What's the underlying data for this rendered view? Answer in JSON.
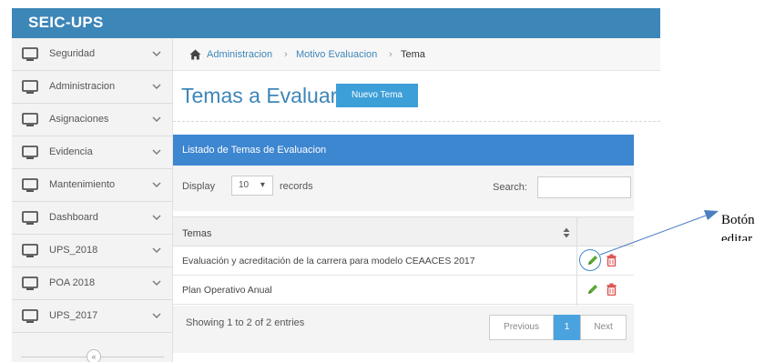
{
  "app": {
    "brand": "SEIC-UPS"
  },
  "sidebar": {
    "items": [
      {
        "label": "Seguridad"
      },
      {
        "label": "Administracion"
      },
      {
        "label": "Asignaciones"
      },
      {
        "label": "Evidencia"
      },
      {
        "label": "Mantenimiento"
      },
      {
        "label": "Dashboard"
      },
      {
        "label": "UPS_2018"
      },
      {
        "label": "POA 2018"
      },
      {
        "label": "UPS_2017"
      }
    ],
    "collapse_glyph": "«"
  },
  "breadcrumb": {
    "items": [
      "Administracion",
      "Motivo Evaluacion",
      "Tema"
    ],
    "separator": "›"
  },
  "page": {
    "title": "Temas a Evaluar",
    "new_button": "Nuevo Tema"
  },
  "panel": {
    "heading": "Listado de Temas de Evaluacion",
    "display_label": "Display",
    "length_value": "10",
    "length_arrow": "▾",
    "records_label": "records",
    "search_label": "Search:",
    "search_value": ""
  },
  "table": {
    "column_header": "Temas",
    "rows": [
      {
        "tema": "Evaluación y acreditación de la carrera para modelo CEAACES 2017"
      },
      {
        "tema": "Plan Operativo Anual"
      }
    ],
    "info": "Showing 1 to 2 of 2 entries",
    "pager": {
      "previous": "Previous",
      "current": "1",
      "next": "Next"
    }
  },
  "annotation": {
    "line1": "Botón",
    "line2": "editar"
  },
  "colors": {
    "brand_blue": "#3d86b8",
    "panel_blue": "#3d86d0",
    "edit_green": "#5aa832",
    "delete_red": "#d9534f"
  },
  "icons": {
    "sidebar": "monitor-icon",
    "chevron": "chevron-down-icon",
    "home": "home-icon",
    "edit": "pencil-icon",
    "delete": "trash-icon",
    "sort": "sort-icon"
  }
}
